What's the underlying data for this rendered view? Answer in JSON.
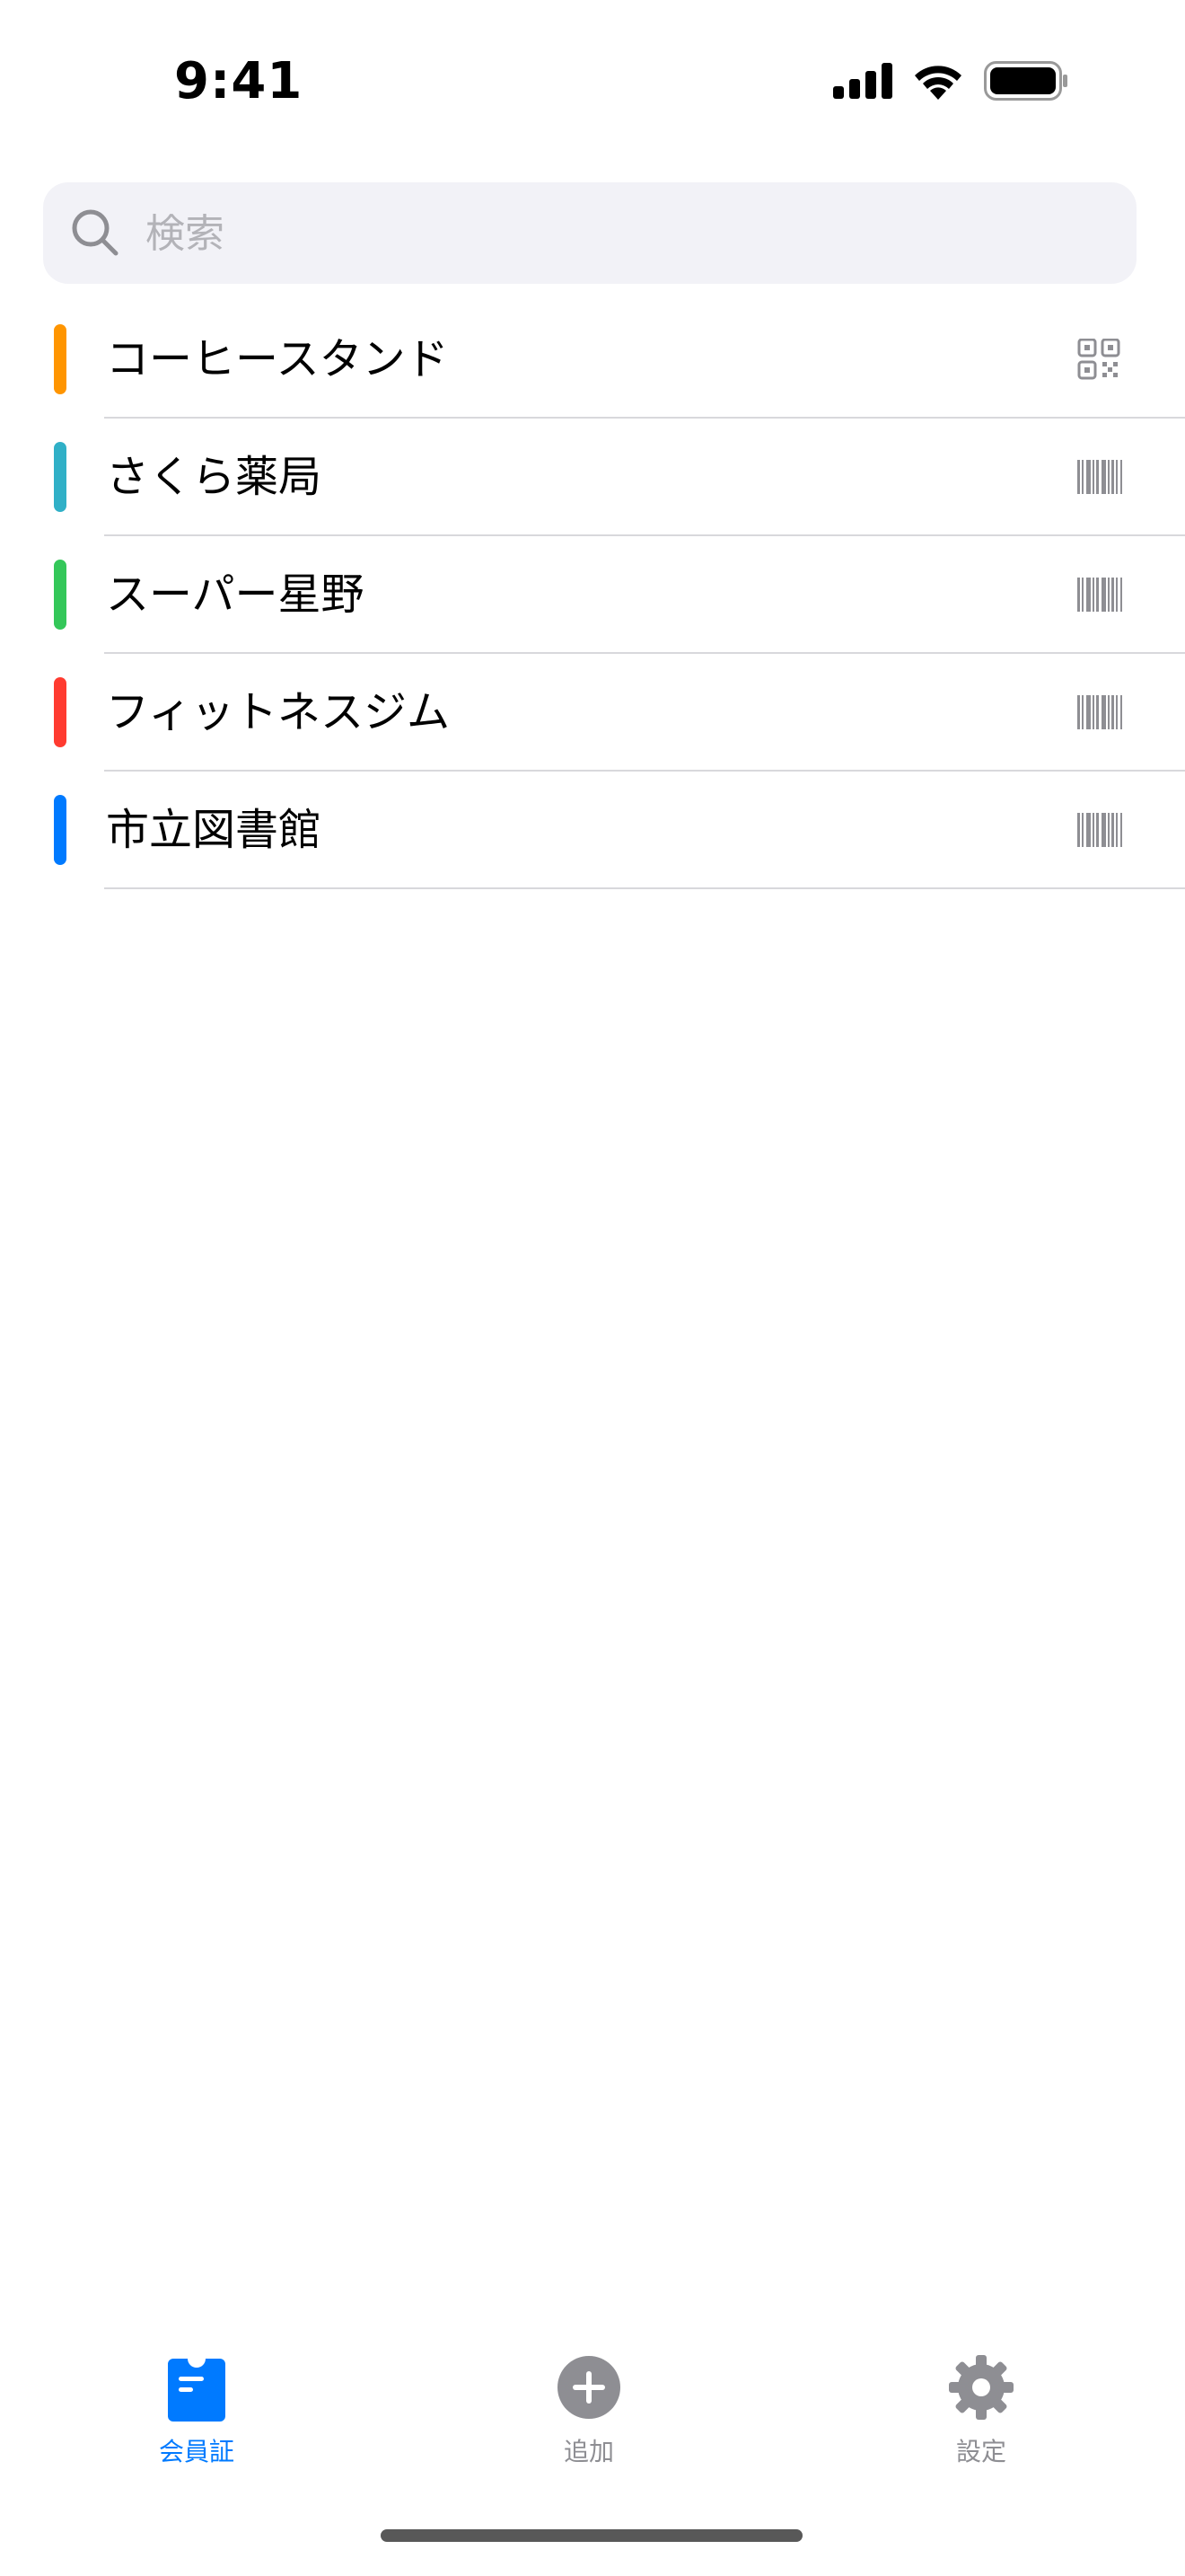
{
  "status_bar": {
    "time": "9:41"
  },
  "search": {
    "placeholder": "検索",
    "value": ""
  },
  "cards": [
    {
      "name": "コーヒースタンド",
      "color": "#ff9500",
      "code_type": "qr-code-icon"
    },
    {
      "name": "さくら薬局",
      "color": "#30b0c7",
      "code_type": "barcode-icon"
    },
    {
      "name": "スーパー星野",
      "color": "#34c759",
      "code_type": "barcode-icon"
    },
    {
      "name": "フィットネスジム",
      "color": "#ff3b30",
      "code_type": "barcode-icon"
    },
    {
      "name": "市立図書館",
      "color": "#007aff",
      "code_type": "barcode-icon"
    }
  ],
  "tab_bar": {
    "tabs": [
      {
        "label": "会員証",
        "icon": "membership-card-icon",
        "active": true
      },
      {
        "label": "追加",
        "icon": "add-circle-icon",
        "active": false
      },
      {
        "label": "設定",
        "icon": "gear-icon",
        "active": false
      }
    ],
    "active_color": "#007aff",
    "inactive_color": "#8e8e93"
  }
}
